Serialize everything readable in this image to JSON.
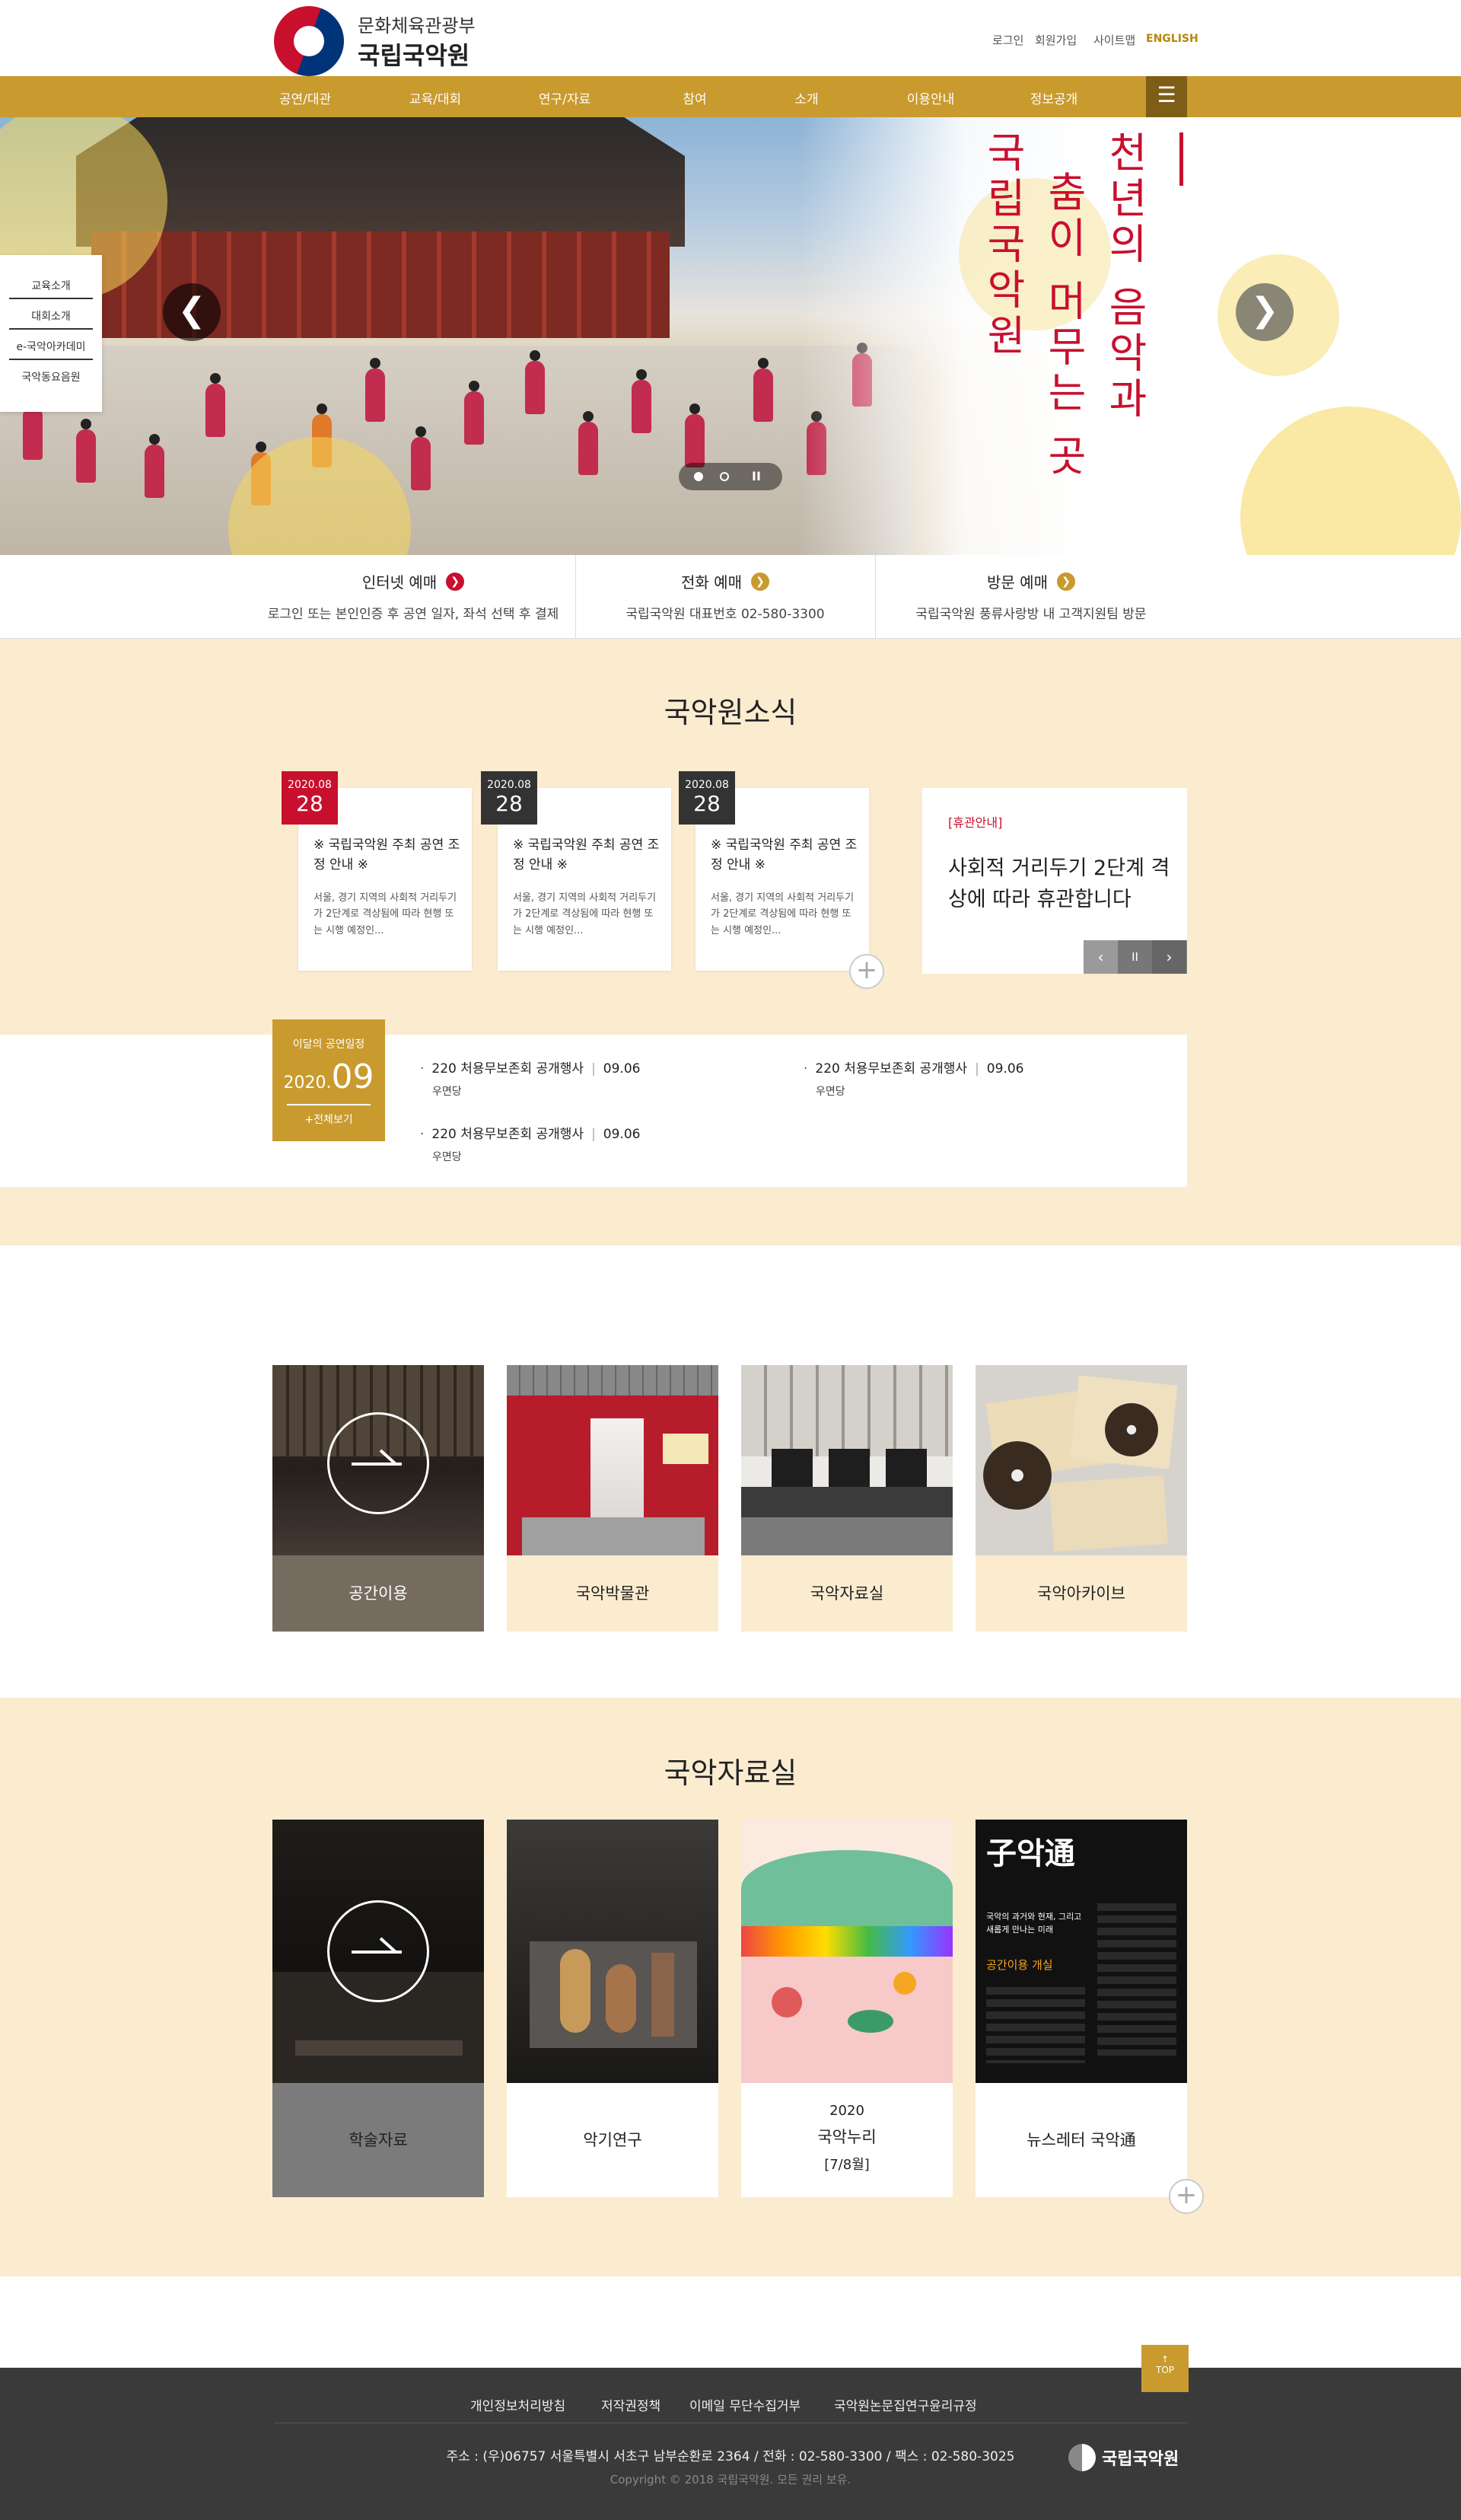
{
  "header": {
    "ministry": "문화체육관광부",
    "org_name": "국립국악원",
    "util": [
      "로그인",
      "회원가입",
      "사이트맵"
    ],
    "english": "ENGLISH"
  },
  "nav": {
    "items": [
      "공연/대관",
      "교육/대회",
      "연구/자료",
      "참여",
      "소개",
      "이용안내",
      "정보공개"
    ],
    "menu_icon": "☰"
  },
  "hero": {
    "slogan_col1": "국립국악원",
    "slogan_col2": "춤이 머무는 곳",
    "slogan_col3": "천년의 음악과",
    "prev": "❮",
    "next": "❯",
    "pause": "II"
  },
  "quick_links": [
    "교육소개",
    "대회소개",
    "e-국악아카데미",
    "국악동요음원"
  ],
  "reservation": [
    {
      "title": "인터넷 예매",
      "desc": "로그인 또는 본인인증 후 공연 일자, 좌석 선택 후 결제",
      "arrow": "❯",
      "color": "#c8102e"
    },
    {
      "title": "전화 예매",
      "desc": "국립국악원 대표번호 02-580-3300",
      "arrow": "❯",
      "color": "#c99a2e"
    },
    {
      "title": "방문 예매",
      "desc": "국립국악원 풍류사랑방 내 고객지원팀 방문",
      "arrow": "❯",
      "color": "#c99a2e"
    }
  ],
  "news": {
    "title": "국악원소식",
    "cards": [
      {
        "ym": "2020.08",
        "d": "28",
        "color": "#c8102e",
        "title": "※ 국립국악원 주최 공연 조정 안내 ※",
        "body": "서울, 경기 지역의 사회적 거리두기가 2단계로 격상됨에 따라 현행 또는 시행 예정인..."
      },
      {
        "ym": "2020.08",
        "d": "28",
        "color": "#333333",
        "title": "※ 국립국악원 주최 공연 조정 안내 ※",
        "body": "서울, 경기 지역의 사회적 거리두기가 2단계로 격상됨에 따라 현행 또는 시행 예정인..."
      },
      {
        "ym": "2020.08",
        "d": "28",
        "color": "#333333",
        "title": "※ 국립국악원 주최 공연 조정 안내 ※",
        "body": "서울, 경기 지역의 사회적 거리두기가 2단계로 격상됨에 따라 현행 또는 시행 예정인..."
      }
    ],
    "more": "+",
    "notice": {
      "tag": "[휴관안내]",
      "title": "사회적 거리두기 2단계 격상에 따라 휴관합니다",
      "prev": "‹",
      "pause": "II",
      "next": "›"
    }
  },
  "schedule": {
    "label": "이달의 공연일정",
    "year": "2020.",
    "month": "09",
    "all": "+전체보기",
    "items": [
      {
        "title": "220 처용무보존회 공개행사",
        "date": "09.06",
        "venue": "우면당"
      },
      {
        "title": "220 처용무보존회 공개행사",
        "date": "09.06",
        "venue": "우면당"
      },
      {
        "title": "220 처용무보존회 공개행사",
        "date": "09.06",
        "venue": "우면당"
      }
    ]
  },
  "facilities": [
    "공간이용",
    "국악박물관",
    "국악자료실",
    "국악아카이브"
  ],
  "archive": {
    "title": "국악자료실",
    "cards": [
      {
        "label": "학술자료"
      },
      {
        "label": "악기연구"
      },
      {
        "label_line1": "2020",
        "label_line2": "국악누리",
        "label_line3": "[7/8월]"
      },
      {
        "label": "뉴스레터 국악通"
      }
    ],
    "more": "+",
    "newsletter_logo": "子악通",
    "newsletter_headline": "국악의 과거와 현재, 그리고 새롭게 만나는 미래",
    "newsletter_sub": "공간이용 개실"
  },
  "footer": {
    "top": "TOP",
    "links": [
      "개인정보처리방침",
      "저작권정책",
      "이메일 무단수집거부",
      "국악원논문집연구윤리규정"
    ],
    "address": "주소 : (우)06757 서울특별시 서초구 남부순환로 2364 / 전화 : 02-580-3300 / 팩스 : 02-580-3025",
    "copyright": "Copyright © 2018 국립국악원. 모든 권리 보유.",
    "logo": "국립국악원"
  }
}
